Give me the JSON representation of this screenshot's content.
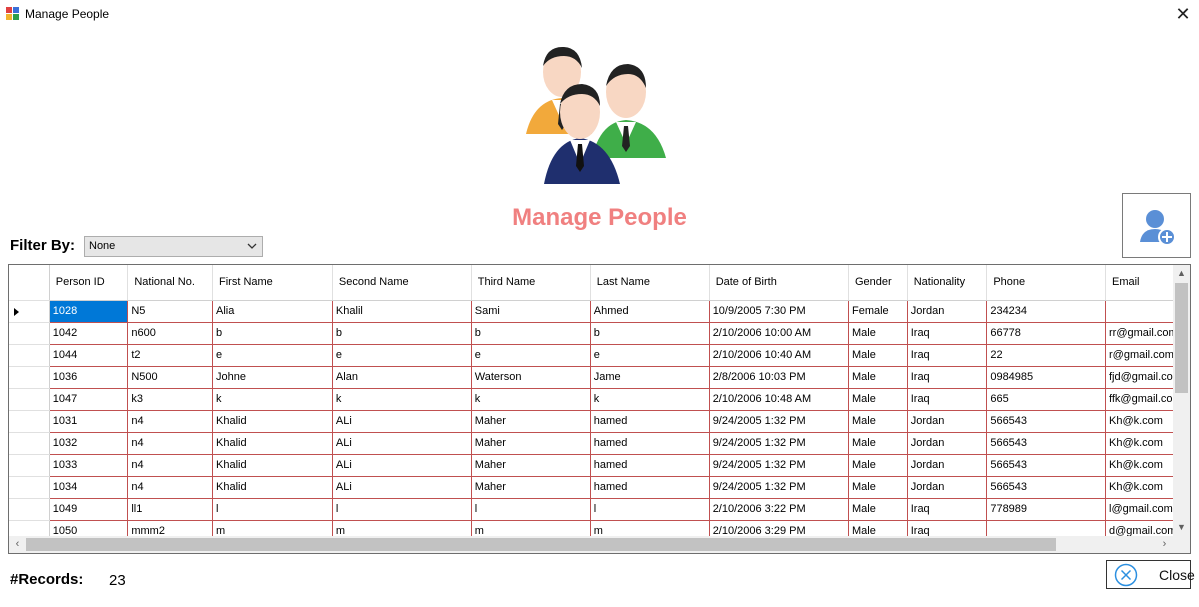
{
  "window": {
    "title": "Manage People",
    "close_glyph": "✕"
  },
  "header": {
    "title": "Manage People",
    "image_icon": "people-group-icon"
  },
  "add_person_button": {
    "icon": "add-person-icon"
  },
  "filter": {
    "label": "Filter By:",
    "selected": "None"
  },
  "grid": {
    "columns": [
      "Person ID",
      "National No.",
      "First Name",
      "Second Name",
      "Third Name",
      "Last Name",
      "Date of Birth",
      "Gender",
      "Nationality",
      "Phone",
      "Email"
    ],
    "rows": [
      [
        "1028",
        "N5",
        "Alia",
        "Khalil",
        "Sami",
        "Ahmed",
        "10/9/2005 7:30 PM",
        "Female",
        "Jordan",
        "234234",
        ""
      ],
      [
        "1042",
        "n600",
        "b",
        "b",
        "b",
        "b",
        "2/10/2006 10:00 AM",
        "Male",
        "Iraq",
        "66778",
        "rr@gmail.com"
      ],
      [
        "1044",
        "t2",
        "e",
        "e",
        "e",
        "e",
        "2/10/2006 10:40 AM",
        "Male",
        "Iraq",
        "22",
        "r@gmail.com"
      ],
      [
        "1036",
        "N500",
        "Johne",
        "Alan",
        "Waterson",
        "Jame",
        "2/8/2006 10:03 PM",
        "Male",
        "Iraq",
        "0984985",
        "fjd@gmail.com"
      ],
      [
        "1047",
        "k3",
        "k",
        "k",
        "k",
        "k",
        "2/10/2006 10:48 AM",
        "Male",
        "Iraq",
        "665",
        "ffk@gmail.com"
      ],
      [
        "1031",
        "n4",
        "Khalid",
        "ALi",
        "Maher",
        "hamed",
        "9/24/2005 1:32 PM",
        "Male",
        "Jordan",
        "566543",
        "Kh@k.com"
      ],
      [
        "1032",
        "n4",
        "Khalid",
        "ALi",
        "Maher",
        "hamed",
        "9/24/2005 1:32 PM",
        "Male",
        "Jordan",
        "566543",
        "Kh@k.com"
      ],
      [
        "1033",
        "n4",
        "Khalid",
        "ALi",
        "Maher",
        "hamed",
        "9/24/2005 1:32 PM",
        "Male",
        "Jordan",
        "566543",
        "Kh@k.com"
      ],
      [
        "1034",
        "n4",
        "Khalid",
        "ALi",
        "Maher",
        "hamed",
        "9/24/2005 1:32 PM",
        "Male",
        "Jordan",
        "566543",
        "Kh@k.com"
      ],
      [
        "1049",
        "ll1",
        "l",
        "l",
        "l",
        "l",
        "2/10/2006 3:22 PM",
        "Male",
        "Iraq",
        "778989",
        "l@gmail.com"
      ],
      [
        "1050",
        "mmm2",
        "m",
        "m",
        "m",
        "m",
        "2/10/2006 3:29 PM",
        "Male",
        "Iraq",
        "",
        "d@gmail.com"
      ]
    ],
    "selected_row": 0
  },
  "footer": {
    "records_label": "#Records:",
    "records_count": "23",
    "close_label": "Close",
    "close_icon": "close-circle-icon"
  },
  "colors": {
    "title_accent": "#f08080",
    "grid_line": "#c05050",
    "selection": "#0078d7"
  }
}
